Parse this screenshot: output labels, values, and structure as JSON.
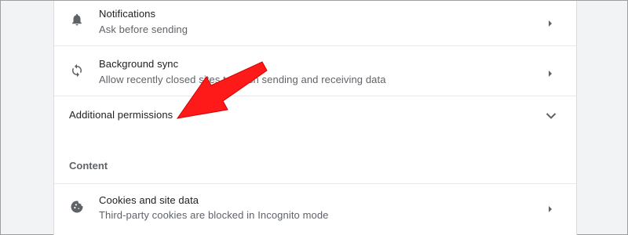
{
  "permissions": {
    "notifications": {
      "title": "Notifications",
      "subtitle": "Ask before sending",
      "icon": "bell-icon"
    },
    "background_sync": {
      "title": "Background sync",
      "subtitle": "Allow recently closed sites to finish sending and receiving data",
      "icon": "sync-icon"
    },
    "additional": {
      "label": "Additional permissions",
      "icon": "chevron-down-icon"
    }
  },
  "content_section": {
    "heading": "Content",
    "cookies": {
      "title": "Cookies and site data",
      "subtitle": "Third-party cookies are blocked in Incognito mode",
      "icon": "cookie-icon"
    }
  },
  "annotation": {
    "color": "#ff0000",
    "icon": "red-arrow-annotation"
  },
  "colors": {
    "text_primary": "#202124",
    "text_secondary": "#5f6368",
    "divider": "#e8eaed",
    "background": "#f1f3f4"
  }
}
